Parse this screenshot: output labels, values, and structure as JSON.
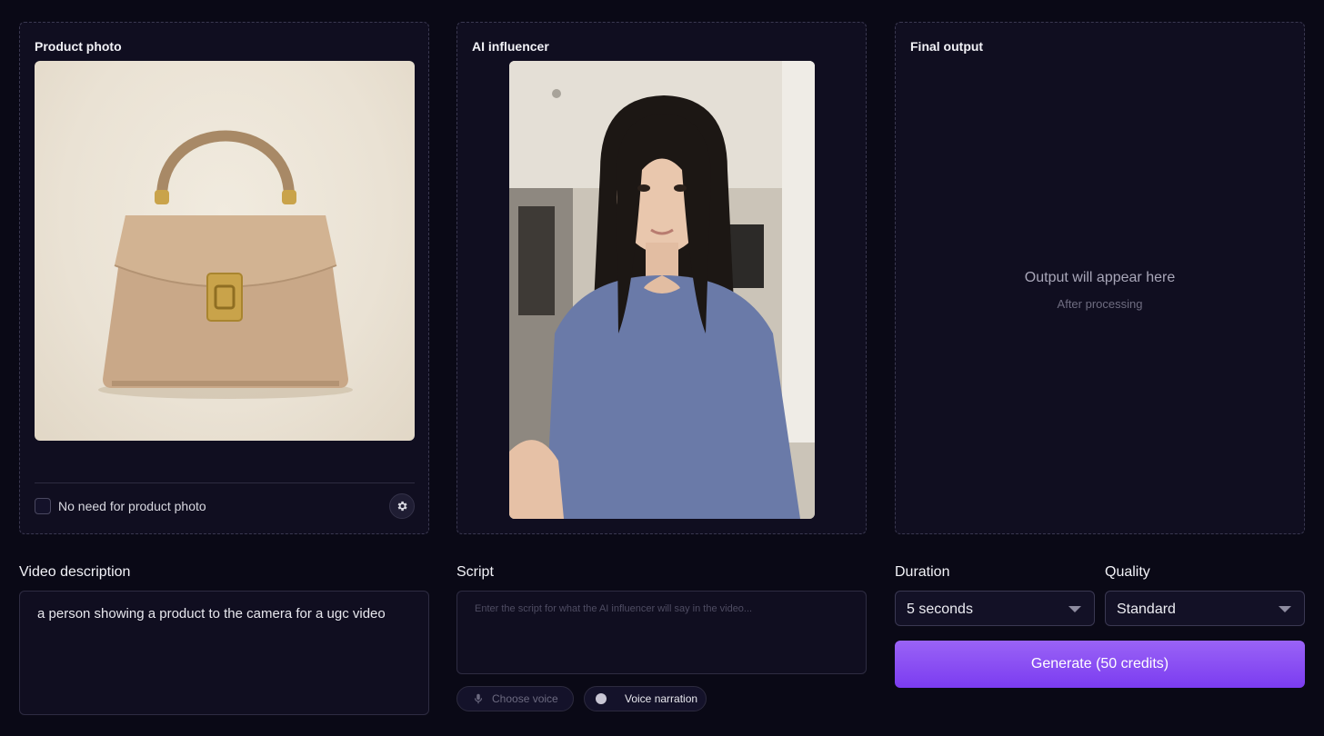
{
  "product_panel": {
    "title": "Product photo",
    "image_alt": "Tan leather top-handle handbag with gold clasp",
    "no_photo_label": "No need for product photo",
    "no_photo_checked": false
  },
  "influencer_panel": {
    "title": "AI influencer",
    "image_alt": "Woman with long dark hair in a blue long-sleeve top taking a selfie indoors"
  },
  "output_panel": {
    "title": "Final output",
    "placeholder": "Output will appear here",
    "subtext": "After processing"
  },
  "video_description": {
    "label": "Video description",
    "value": "a person showing a product to the camera for a ugc video"
  },
  "script": {
    "label": "Script",
    "placeholder": "Enter the script for what the AI influencer will say in the video...",
    "choose_voice_label": "Choose voice",
    "voice_narration_label": "Voice narration",
    "voice_narration_on": false
  },
  "duration": {
    "label": "Duration",
    "selected": "5 seconds"
  },
  "quality": {
    "label": "Quality",
    "selected": "Standard"
  },
  "generate_button": {
    "label": "Generate (50 credits)"
  },
  "colors": {
    "background": "#0a0916",
    "panel": "#100e20",
    "accent": "#8b4ff4"
  }
}
